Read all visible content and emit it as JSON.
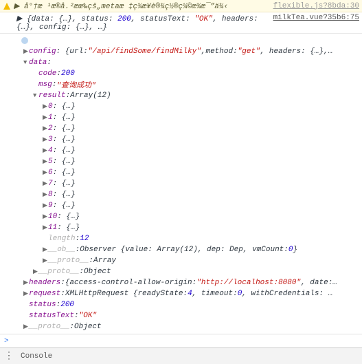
{
  "warning": {
    "text": "▶ å°†æ ¹æ®å.²æœ‰çš„metaæ ‡ç¾æ¥è®¾ç½®ç¼©æ¾æ¯”ä¾‹",
    "source": "flexible.js?8bda:30"
  },
  "log": {
    "summary_prefix": "▶ {data: {…}, status: ",
    "summary_status": "200",
    "summary_mid": ", statusText: ",
    "summary_statusText": "\"OK\"",
    "summary_suffix": ", headers: {…}, config: {…}, …}",
    "source": "milkTea.vue?35b6:75"
  },
  "config": {
    "key": "config",
    "url_key": "url",
    "url": "\"/api/findSome/findMilky\"",
    "method_key": "method",
    "method": "\"get\"",
    "suffix": ", headers: {…},…"
  },
  "data": {
    "key": "data",
    "code_key": "code",
    "code": "200",
    "msg_key": "msg",
    "msg": "\"查询成功\"",
    "result_key": "result",
    "result_type": "Array(12)",
    "items": [
      {
        "k": "0",
        "v": "{…}"
      },
      {
        "k": "1",
        "v": "{…}"
      },
      {
        "k": "2",
        "v": "{…}"
      },
      {
        "k": "3",
        "v": "{…}"
      },
      {
        "k": "4",
        "v": "{…}"
      },
      {
        "k": "5",
        "v": "{…}"
      },
      {
        "k": "6",
        "v": "{…}"
      },
      {
        "k": "7",
        "v": "{…}"
      },
      {
        "k": "8",
        "v": "{…}"
      },
      {
        "k": "9",
        "v": "{…}"
      },
      {
        "k": "10",
        "v": "{…}"
      },
      {
        "k": "11",
        "v": "{…}"
      }
    ],
    "length_key": "length",
    "length": "12",
    "ob_key": "__ob__",
    "ob_val": "Observer {value: Array(12), dep: Dep, vmCount: ",
    "ob_num": "0",
    "ob_suffix": "}",
    "proto_key": "__proto__",
    "proto_arr": "Array",
    "proto_obj": "Object"
  },
  "headers": {
    "key": "headers",
    "prefix": "{access-control-allow-origin: ",
    "origin": "\"http://localhost:8080\"",
    "suffix": ", date:…"
  },
  "request": {
    "key": "request",
    "prefix": "XMLHttpRequest {readyState: ",
    "ready": "4",
    "mid1": ", timeout: ",
    "timeout": "0",
    "mid2": ", withCredentials: …"
  },
  "status": {
    "key": "status",
    "val": "200"
  },
  "statusText": {
    "key": "statusText",
    "val": "\"OK\""
  },
  "proto": {
    "key": "__proto__",
    "val": "Object"
  },
  "prompt": ">",
  "bottom": {
    "label": "Console"
  }
}
